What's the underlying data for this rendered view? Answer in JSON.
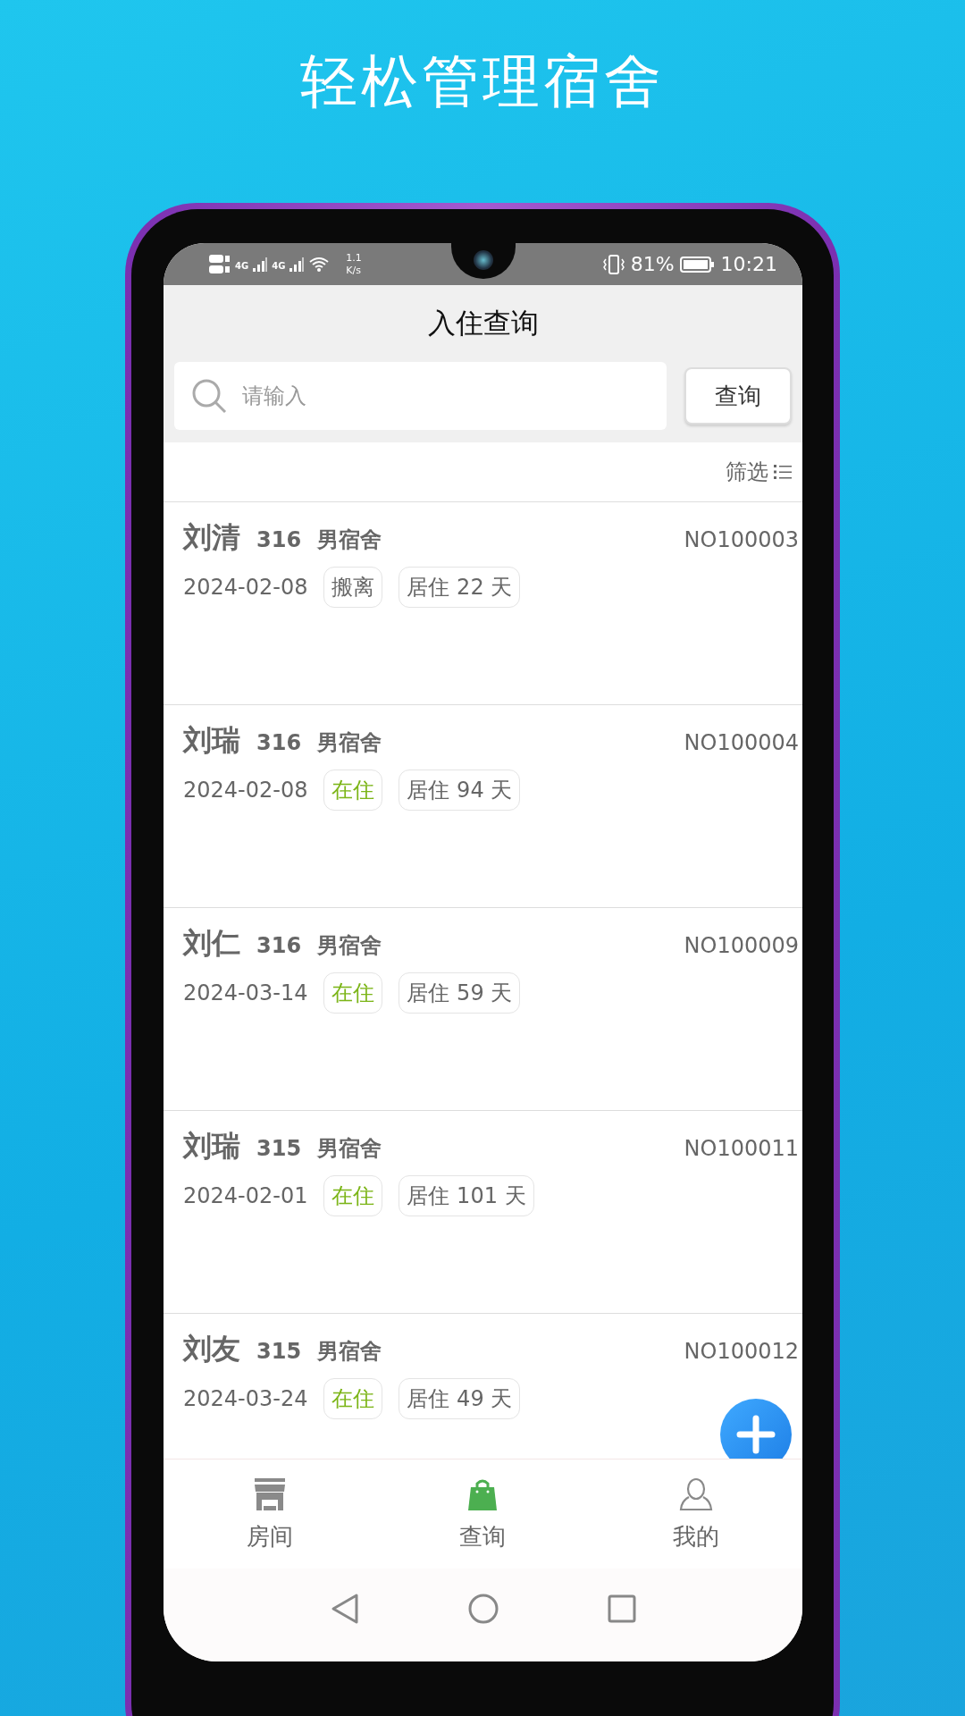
{
  "headline": "轻松管理宿舍",
  "status_bar": {
    "network_1": "4G",
    "network_2": "4G",
    "speed_value": "1.1",
    "speed_unit": "K/s",
    "battery": "81%",
    "time": "10:21"
  },
  "header": {
    "title": "入住查询"
  },
  "search": {
    "placeholder": "请输入",
    "button": "查询"
  },
  "filter": {
    "label": "筛选"
  },
  "records": [
    {
      "name": "刘清",
      "room": "316",
      "dorm": "男宿舍",
      "number": "NO100003",
      "date": "2024-02-08",
      "status": "搬离",
      "kind": "moved",
      "stay": "居住 22 天"
    },
    {
      "name": "刘瑞",
      "room": "316",
      "dorm": "男宿舍",
      "number": "NO100004",
      "date": "2024-02-08",
      "status": "在住",
      "kind": "living",
      "stay": "居住 94 天"
    },
    {
      "name": "刘仁",
      "room": "316",
      "dorm": "男宿舍",
      "number": "NO100009",
      "date": "2024-03-14",
      "status": "在住",
      "kind": "living",
      "stay": "居住 59 天"
    },
    {
      "name": "刘瑞",
      "room": "315",
      "dorm": "男宿舍",
      "number": "NO100011",
      "date": "2024-02-01",
      "status": "在住",
      "kind": "living",
      "stay": "居住 101 天"
    },
    {
      "name": "刘友",
      "room": "315",
      "dorm": "男宿舍",
      "number": "NO100012",
      "date": "2024-03-24",
      "status": "在住",
      "kind": "living",
      "stay": "居住 49 天"
    }
  ],
  "tabs": [
    {
      "label": "房间",
      "kind": "store",
      "selected": false
    },
    {
      "label": "查询",
      "kind": "bag",
      "selected": true
    },
    {
      "label": "我的",
      "kind": "person",
      "selected": false
    }
  ]
}
